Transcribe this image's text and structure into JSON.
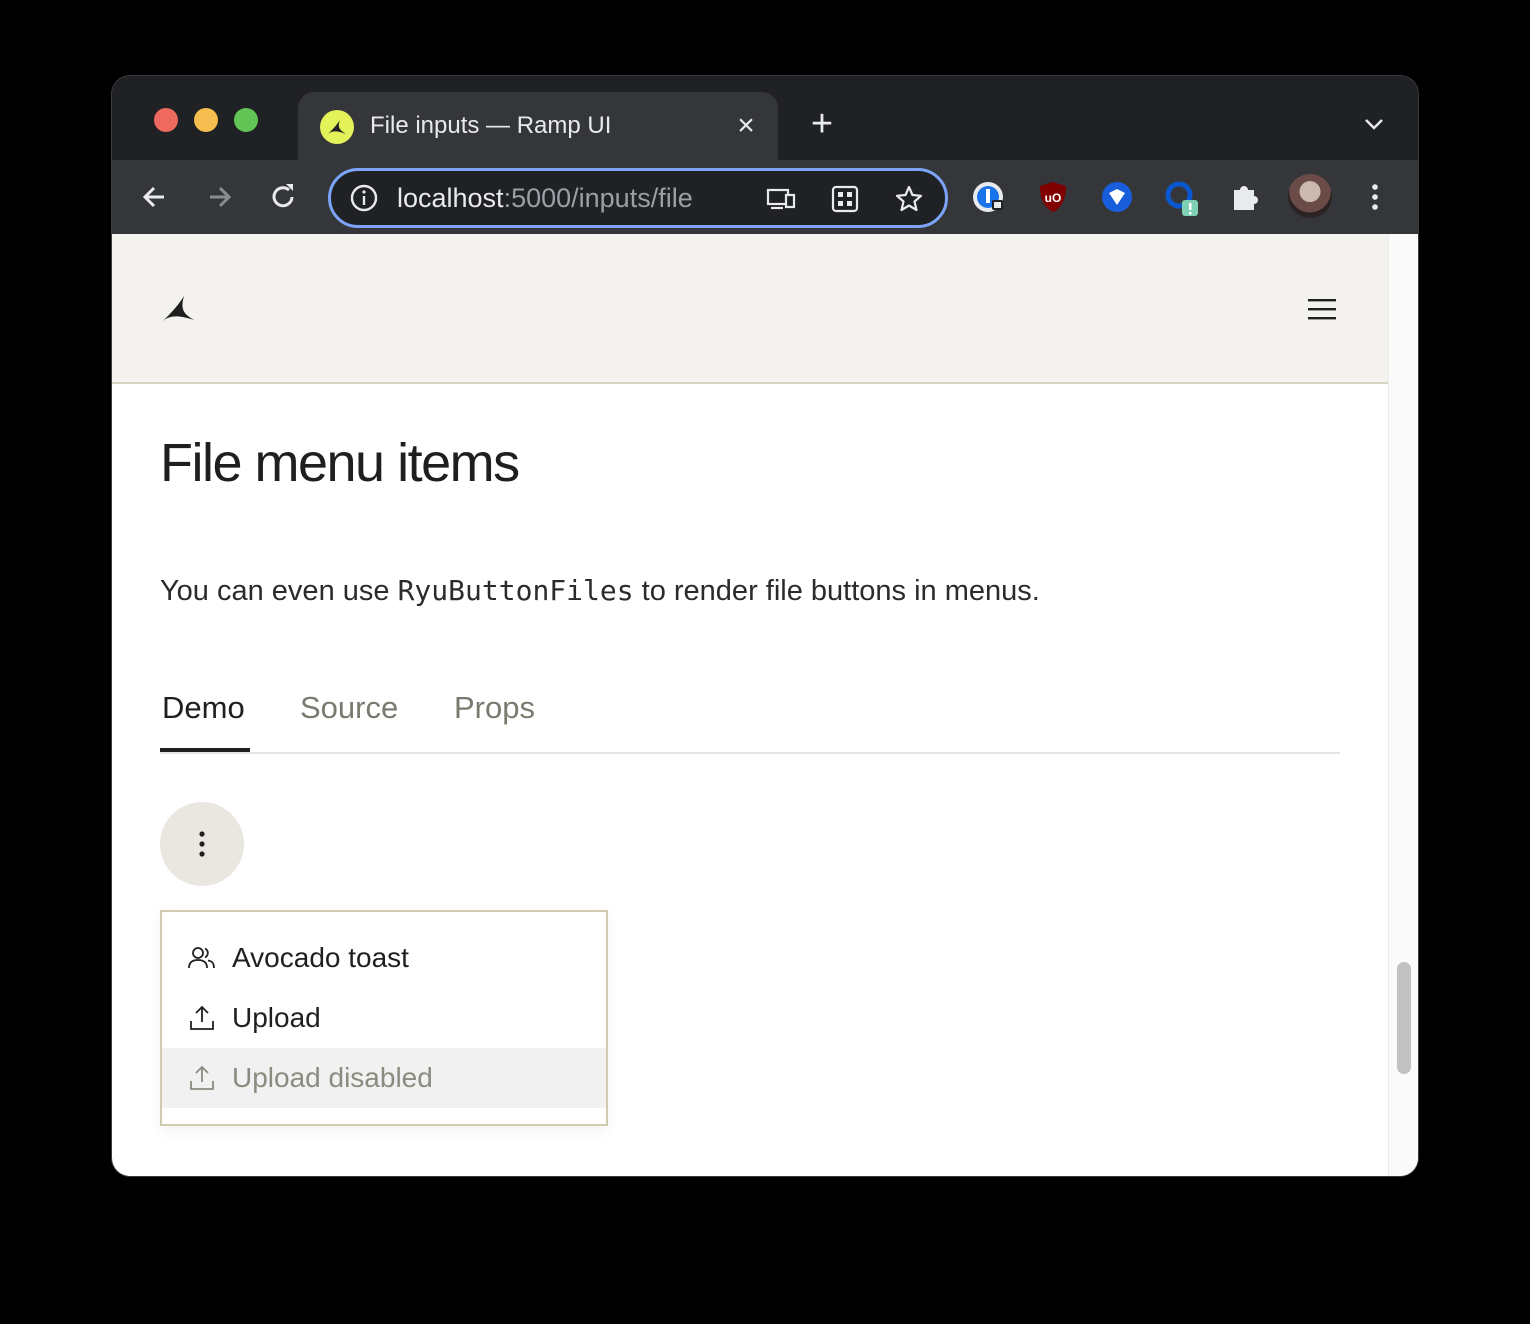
{
  "browser": {
    "tab_title": "File inputs — Ramp UI",
    "tab_close": "×",
    "new_tab": "+",
    "url_host": "localhost",
    "url_rest": ":5000/inputs/file",
    "icons": [
      "back-icon",
      "forward-icon",
      "reload-icon",
      "info-icon",
      "cast-icon",
      "qr-icon",
      "star-icon",
      "password-manager-icon",
      "ublock-icon",
      "bitwarden-icon",
      "extension-alert-icon",
      "puzzle-icon",
      "avatar",
      "kebab-menu-icon"
    ],
    "accent": "#7ca4f8"
  },
  "page": {
    "heading": "File menu items",
    "description_before": "You can even use ",
    "description_code": "RyuButtonFiles",
    "description_after": " to render file buttons in menus.",
    "tabs": [
      {
        "label": "Demo",
        "active": true
      },
      {
        "label": "Source",
        "active": false
      },
      {
        "label": "Props",
        "active": false
      }
    ],
    "menu": {
      "items": [
        {
          "label": "Avocado toast",
          "icon": "users-icon",
          "disabled": false
        },
        {
          "label": "Upload",
          "icon": "upload-icon",
          "disabled": false
        },
        {
          "label": "Upload disabled",
          "icon": "upload-icon",
          "disabled": true
        }
      ]
    }
  }
}
